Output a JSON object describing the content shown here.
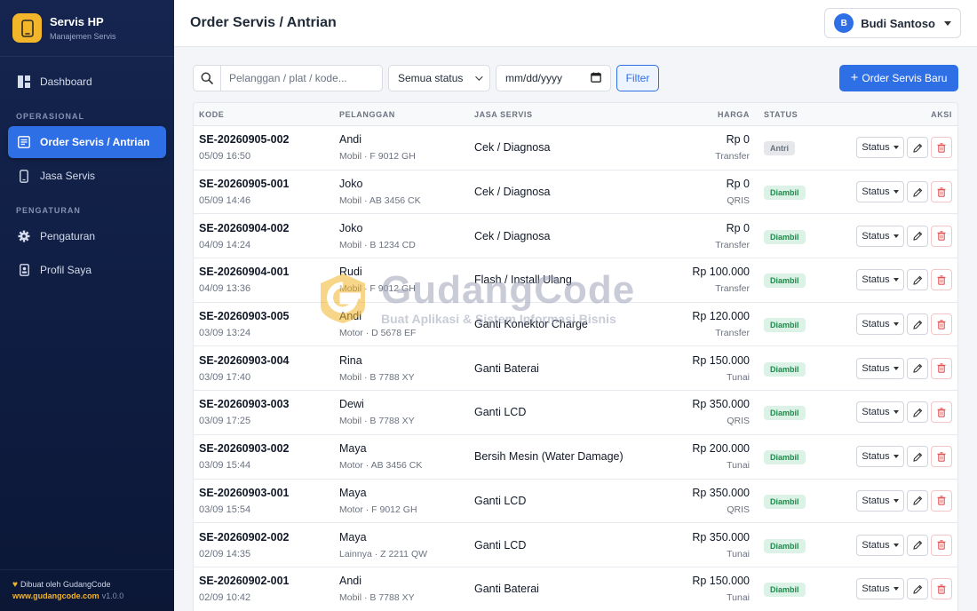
{
  "brand": {
    "title": "Servis HP",
    "subtitle": "Manajemen Servis"
  },
  "nav": {
    "dashboard": "Dashboard",
    "section_operasional": "OPERASIONAL",
    "order_servis": "Order Servis / Antrian",
    "jasa_servis": "Jasa Servis",
    "section_pengaturan": "PENGATURAN",
    "pengaturan": "Pengaturan",
    "profil": "Profil Saya"
  },
  "footer": {
    "credit": "Dibuat oleh GudangCode",
    "link": "www.gudangcode.com",
    "version": "v1.0.0"
  },
  "header": {
    "title": "Order Servis / Antrian",
    "user_initial": "B",
    "user_name": "Budi Santoso"
  },
  "toolbar": {
    "search_placeholder": "Pelanggan / plat / kode...",
    "status_select": "Semua status",
    "date_placeholder": "mm/dd/yyyy",
    "filter_label": "Filter",
    "new_order_label": "Order Servis Baru"
  },
  "table": {
    "headers": {
      "kode": "KODE",
      "pelanggan": "PELANGGAN",
      "jasa": "JASA SERVIS",
      "harga": "HARGA",
      "status": "STATUS",
      "aksi": "AKSI"
    },
    "action_status_label": "Status",
    "rows": [
      {
        "kode": "SE-20260905-002",
        "tanggal": "05/09 16:50",
        "nama": "Andi",
        "kendaraan": "Mobil · F 9012 GH",
        "jasa": "Cek / Diagnosa",
        "harga": "Rp 0",
        "bayar": "Transfer",
        "status": "Antri"
      },
      {
        "kode": "SE-20260905-001",
        "tanggal": "05/09 14:46",
        "nama": "Joko",
        "kendaraan": "Mobil · AB 3456 CK",
        "jasa": "Cek / Diagnosa",
        "harga": "Rp 0",
        "bayar": "QRIS",
        "status": "Diambil"
      },
      {
        "kode": "SE-20260904-002",
        "tanggal": "04/09 14:24",
        "nama": "Joko",
        "kendaraan": "Mobil · B 1234 CD",
        "jasa": "Cek / Diagnosa",
        "harga": "Rp 0",
        "bayar": "Transfer",
        "status": "Diambil"
      },
      {
        "kode": "SE-20260904-001",
        "tanggal": "04/09 13:36",
        "nama": "Rudi",
        "kendaraan": "Mobil · F 9012 GH",
        "jasa": "Flash / Install Ulang",
        "harga": "Rp 100.000",
        "bayar": "Transfer",
        "status": "Diambil"
      },
      {
        "kode": "SE-20260903-005",
        "tanggal": "03/09 13:24",
        "nama": "Andi",
        "kendaraan": "Motor · D 5678 EF",
        "jasa": "Ganti Konektor Charge",
        "harga": "Rp 120.000",
        "bayar": "Transfer",
        "status": "Diambil"
      },
      {
        "kode": "SE-20260903-004",
        "tanggal": "03/09 17:40",
        "nama": "Rina",
        "kendaraan": "Mobil · B 7788 XY",
        "jasa": "Ganti Baterai",
        "harga": "Rp 150.000",
        "bayar": "Tunai",
        "status": "Diambil"
      },
      {
        "kode": "SE-20260903-003",
        "tanggal": "03/09 17:25",
        "nama": "Dewi",
        "kendaraan": "Mobil · B 7788 XY",
        "jasa": "Ganti LCD",
        "harga": "Rp 350.000",
        "bayar": "QRIS",
        "status": "Diambil"
      },
      {
        "kode": "SE-20260903-002",
        "tanggal": "03/09 15:44",
        "nama": "Maya",
        "kendaraan": "Motor · AB 3456 CK",
        "jasa": "Bersih Mesin (Water Damage)",
        "harga": "Rp 200.000",
        "bayar": "Tunai",
        "status": "Diambil"
      },
      {
        "kode": "SE-20260903-001",
        "tanggal": "03/09 15:54",
        "nama": "Maya",
        "kendaraan": "Motor · F 9012 GH",
        "jasa": "Ganti LCD",
        "harga": "Rp 350.000",
        "bayar": "QRIS",
        "status": "Diambil"
      },
      {
        "kode": "SE-20260902-002",
        "tanggal": "02/09 14:35",
        "nama": "Maya",
        "kendaraan": "Lainnya · Z 2211 QW",
        "jasa": "Ganti LCD",
        "harga": "Rp 350.000",
        "bayar": "Tunai",
        "status": "Diambil"
      },
      {
        "kode": "SE-20260902-001",
        "tanggal": "02/09 10:42",
        "nama": "Andi",
        "kendaraan": "Mobil · B 7788 XY",
        "jasa": "Ganti Baterai",
        "harga": "Rp 150.000",
        "bayar": "Tunai",
        "status": "Diambil"
      }
    ]
  },
  "watermark": {
    "title": "GudangCode",
    "subtitle": "Buat Aplikasi & Sistem Informasi Bisnis"
  },
  "colors": {
    "accent": "#2f6fe6",
    "brand": "#f3b52a",
    "sidebar": "#15254f",
    "status_done": "#1f8a4c",
    "danger": "#e05252"
  }
}
